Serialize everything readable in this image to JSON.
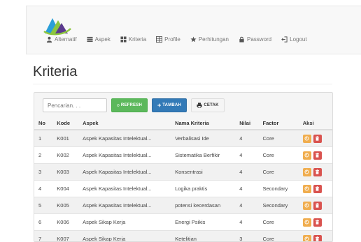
{
  "nav": {
    "items": [
      {
        "label": "Alternatif",
        "icon": "user-icon"
      },
      {
        "label": "Aspek",
        "icon": "list-icon"
      },
      {
        "label": "Kriteria",
        "icon": "grid-icon"
      },
      {
        "label": "Profile",
        "icon": "table-icon"
      },
      {
        "label": "Perhitungan",
        "icon": "star-icon"
      },
      {
        "label": "Password",
        "icon": "lock-icon"
      },
      {
        "label": "Logout",
        "icon": "logout-icon"
      }
    ]
  },
  "page": {
    "title": "Kriteria"
  },
  "toolbar": {
    "search_placeholder": "Pencarian. . .",
    "refresh_label": "REFRESH",
    "add_label": "TAMBAH",
    "print_label": "CETAK"
  },
  "table": {
    "headers": [
      "No",
      "Kode",
      "Aspek",
      "Nama Kriteria",
      "Nilai",
      "Factor",
      "Aksi"
    ],
    "rows": [
      [
        "1",
        "K001",
        "Aspek Kapasitas Intelektual...",
        "Verbalisasi Ide",
        "4",
        "Core"
      ],
      [
        "2",
        "K002",
        "Aspek Kapasitas Intelektual...",
        "Sistematika Berfikir",
        "4",
        "Core"
      ],
      [
        "3",
        "K003",
        "Aspek Kapasitas Intelektual...",
        "Konsentrasi",
        "4",
        "Core"
      ],
      [
        "4",
        "K004",
        "Aspek Kapasitas Intelektual...",
        "Logika praktis",
        "4",
        "Secondary"
      ],
      [
        "5",
        "K005",
        "Aspek Kapasitas Intelektual...",
        "potensi kecerdasan",
        "4",
        "Secondary"
      ],
      [
        "6",
        "K006",
        "Aspek Sikap Kerja",
        "Energi Psikis",
        "4",
        "Core"
      ],
      [
        "7",
        "K007",
        "Aspek Sikap Kerja",
        "Ketelitian",
        "3",
        "Core"
      ]
    ]
  },
  "colors": {
    "refresh": "#5cb85c",
    "add": "#337ab7",
    "edit": "#f0ad4e",
    "delete": "#d9534f"
  }
}
